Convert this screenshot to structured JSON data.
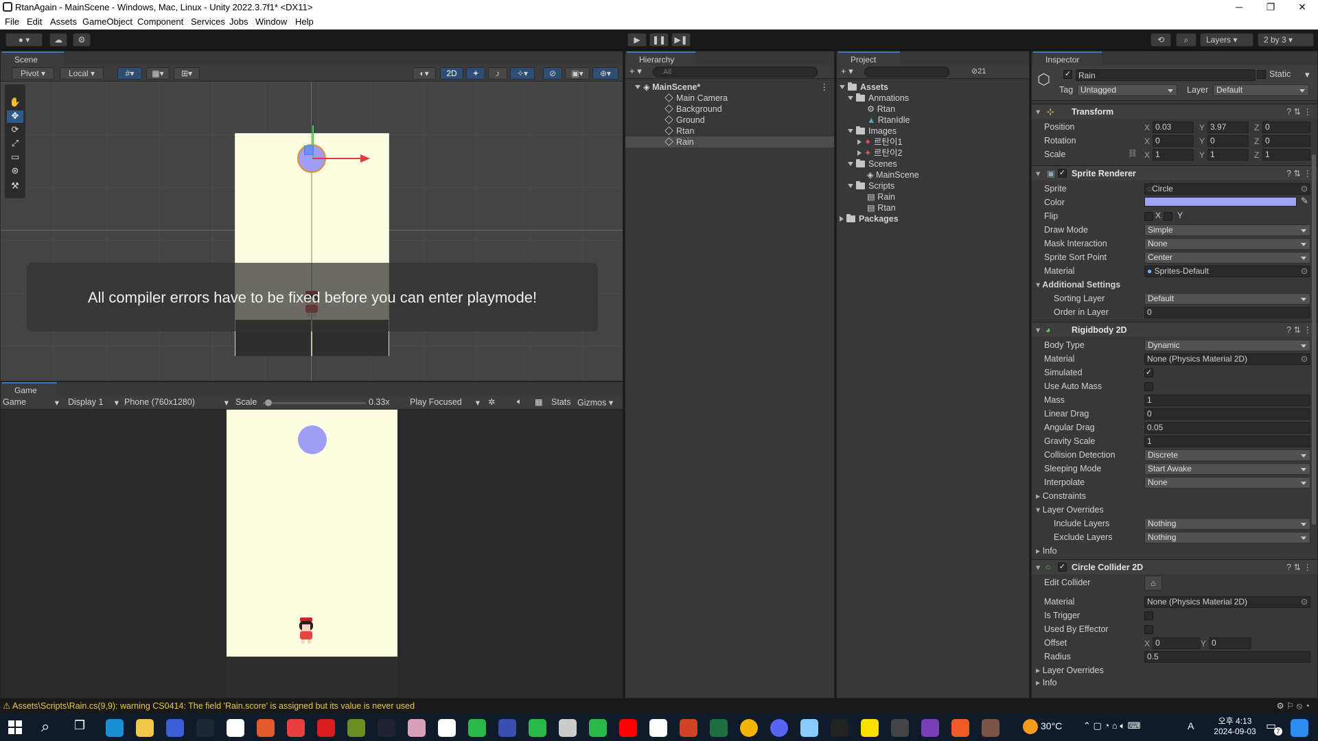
{
  "window": {
    "title": "RtanAgain - MainScene - Windows, Mac, Linux - Unity 2022.3.7f1* <DX11>",
    "min": "─",
    "max": "❐",
    "close": "✕"
  },
  "menu": [
    "File",
    "Edit",
    "Assets",
    "GameObject",
    "Component",
    "Services",
    "Jobs",
    "Window",
    "Help"
  ],
  "toolbar": {
    "layers": "Layers",
    "layout": "2 by 3"
  },
  "scene": {
    "tab": "Scene",
    "pivot": "Pivot",
    "local": "Local",
    "mode2d": "2D",
    "overlay_message": "All compiler errors have to be fixed before you can enter playmode!"
  },
  "game": {
    "tab": "Game",
    "mode": "Game",
    "display": "Display 1",
    "resolution": "Phone (760x1280)",
    "scale_label": "Scale",
    "scale_value": "0.33x",
    "scale_fraction": 0.05,
    "play_focused": "Play Focused",
    "stats": "Stats",
    "gizmos": "Gizmos"
  },
  "hierarchy": {
    "tab": "Hierarchy",
    "search_placeholder": "All",
    "scene": "MainScene*",
    "items": [
      "Main Camera",
      "Background",
      "Ground",
      "Rtan",
      "Rain"
    ],
    "selected": "Rain"
  },
  "project": {
    "tab": "Project",
    "hidden_count": "21",
    "assets": "Assets",
    "animations": "Anmations",
    "anim_items": [
      "Rtan",
      "RtanIdle"
    ],
    "images": "Images",
    "image_items": [
      "르탄이1",
      "르탄이2"
    ],
    "scenes": "Scenes",
    "scene_items": [
      "MainScene"
    ],
    "scripts": "Scripts",
    "script_items": [
      "Rain",
      "Rtan"
    ],
    "packages": "Packages"
  },
  "inspector": {
    "tab": "Inspector",
    "object_name": "Rain",
    "static_label": "Static",
    "tag_label": "Tag",
    "tag": "Untagged",
    "layer_label": "Layer",
    "layer": "Default",
    "transform": {
      "title": "Transform",
      "position": {
        "label": "Position",
        "x": "0.03",
        "y": "3.97",
        "z": "0"
      },
      "rotation": {
        "label": "Rotation",
        "x": "0",
        "y": "0",
        "z": "0"
      },
      "scale": {
        "label": "Scale",
        "x": "1",
        "y": "1",
        "z": "1"
      }
    },
    "sprite_renderer": {
      "title": "Sprite Renderer",
      "sprite_label": "Sprite",
      "sprite": "Circle",
      "color_label": "Color",
      "color": "#a2a2f5",
      "flip_label": "Flip",
      "flip_x": "X",
      "flip_y": "Y",
      "draw_mode_label": "Draw Mode",
      "draw_mode": "Simple",
      "mask_label": "Mask Interaction",
      "mask": "None",
      "sort_point_label": "Sprite Sort Point",
      "sort_point": "Center",
      "material_label": "Material",
      "material": "Sprites-Default",
      "additional": "Additional Settings",
      "sorting_layer_label": "Sorting Layer",
      "sorting_layer": "Default",
      "order_label": "Order in Layer",
      "order": "0"
    },
    "rigidbody": {
      "title": "Rigidbody 2D",
      "body_type_label": "Body Type",
      "body_type": "Dynamic",
      "material_label": "Material",
      "material": "None (Physics Material 2D)",
      "simulated_label": "Simulated",
      "auto_mass_label": "Use Auto Mass",
      "mass_label": "Mass",
      "mass": "1",
      "linear_drag_label": "Linear Drag",
      "linear_drag": "0",
      "angular_drag_label": "Angular Drag",
      "angular_drag": "0.05",
      "gravity_label": "Gravity Scale",
      "gravity": "1",
      "collision_label": "Collision Detection",
      "collision": "Discrete",
      "sleeping_label": "Sleeping Mode",
      "sleeping": "Start Awake",
      "interpolate_label": "Interpolate",
      "interpolate": "None",
      "constraints": "Constraints",
      "layer_overrides": "Layer Overrides",
      "include_label": "Include Layers",
      "include": "Nothing",
      "exclude_label": "Exclude Layers",
      "exclude": "Nothing",
      "info": "Info"
    },
    "circle_collider": {
      "title": "Circle Collider 2D",
      "edit_label": "Edit Collider",
      "material_label": "Material",
      "material": "None (Physics Material 2D)",
      "trigger_label": "Is Trigger",
      "effector_label": "Used By Effector",
      "offset_label": "Offset",
      "offset_x": "0",
      "offset_y": "0",
      "radius_label": "Radius",
      "radius": "0.5",
      "layer_overrides": "Layer Overrides",
      "info": "Info"
    }
  },
  "status": {
    "warning": "Assets\\Scripts\\Rain.cs(9,9): warning CS0414: The field 'Rain.score' is assigned but its value is never used"
  },
  "taskbar": {
    "weather": "30°C",
    "ime": "A",
    "time": "오후 4:13",
    "date": "2024-09-03",
    "notif": "7"
  },
  "colors": {
    "game_bg": "#fffde0",
    "rain": "#9e9ef7",
    "accent": "#3a79bb"
  }
}
